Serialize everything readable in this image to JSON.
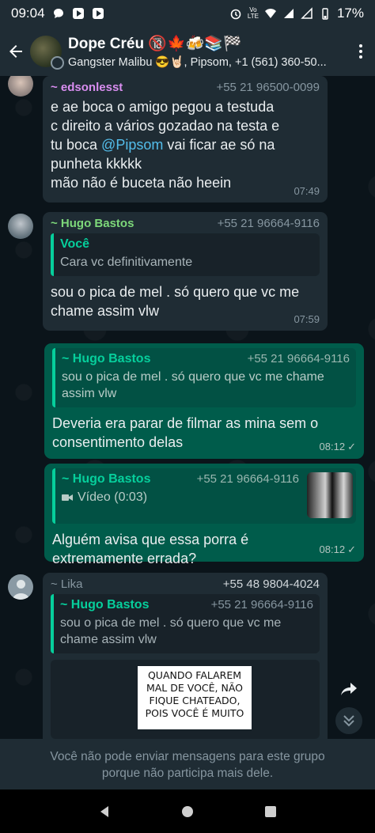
{
  "status_bar": {
    "time": "09:04",
    "battery": "17%",
    "network": "LTE",
    "vo": "Vo"
  },
  "header": {
    "title": "Dope Créu 🔞🍁🍻📚🏁",
    "subtitle": "Gangster Malibu 😎🤘🏻, Pipsom, +1 (561) 360-50..."
  },
  "messages": [
    {
      "sender": "~ edsonlesst",
      "phone": "+55 21 96500-0099",
      "text_parts": [
        "e ae boca o amigo pegou a testuda",
        "c direito a vários gozadao na testa e",
        "tu boca ",
        "@Pipsom",
        " vai ficar ae só na",
        "punheta kkkkk",
        "mão não é buceta não heein"
      ],
      "time": "07:49"
    },
    {
      "sender": "~ Hugo Bastos",
      "phone": "+55 21 96664-9116",
      "quote_name": "Você",
      "quote_text": "Cara vc definitivamente",
      "text_lines": [
        "sou o pica de mel . só quero que vc me",
        "chame assim vlw"
      ],
      "time": "07:59"
    },
    {
      "quote_name": "~ Hugo Bastos",
      "quote_phone": "+55 21 96664-9116",
      "quote_lines": [
        "sou o pica de mel . só quero que vc me chame",
        "assim vlw"
      ],
      "text_lines": [
        "Deveria era parar de filmar as mina sem o",
        "consentimento delas"
      ],
      "time": "08:12"
    },
    {
      "quote_name": "~ Hugo Bastos",
      "quote_phone": "+55 21 96664-9116",
      "quote_media": "Vídeo (0:03)",
      "text_lines": [
        "Alguém avisa que essa porra é",
        "extremamente errada?"
      ],
      "time": "08:12"
    },
    {
      "sender": "~ Lika",
      "phone": "+55 48 9804-4024",
      "quote_name": "~ Hugo Bastos",
      "quote_phone": "+55 21 96664-9116",
      "quote_lines": [
        "sou o pica de mel . só quero que vc me",
        "chame assim vlw"
      ],
      "image_text": [
        "QUANDO FALAREM",
        "MAL DE VOCÊ, NÃO",
        "FIQUE CHATEADO,",
        "POIS VOCÊ É MUITO"
      ]
    }
  ],
  "footer_notice": [
    "Você não pode enviar mensagens para este grupo",
    "porque não participa mais dele."
  ],
  "colors": {
    "header_bg": "#1f2c34",
    "chat_bg": "#0b141a",
    "incoming_bubble": "#1f2c34",
    "outgoing_bubble": "#005c4b",
    "accent_green": "#06cf9c",
    "mention_blue": "#53bdeb",
    "sender_pink": "#d98ef0"
  }
}
